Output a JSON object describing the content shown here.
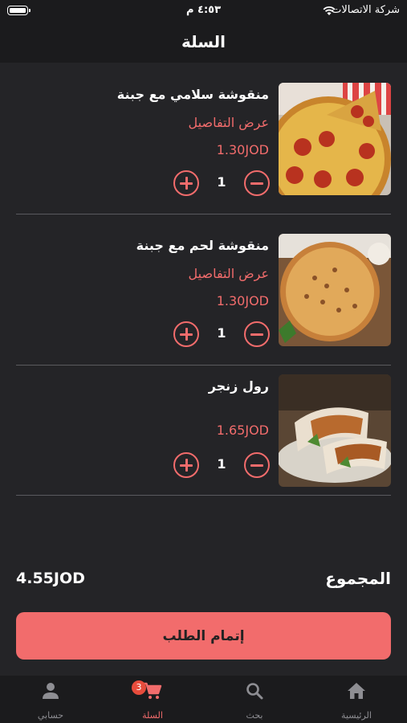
{
  "status_bar": {
    "carrier": "شركة الاتصالات",
    "time": "٤:٥٣ م"
  },
  "header": {
    "title": "السلة"
  },
  "cart": {
    "items": [
      {
        "name": "منقوشة سلامي مع جبنة",
        "details_label": "عرض التفاصيل",
        "price": "1.30JOD",
        "quantity": "1",
        "image": "pepperoni-pizza"
      },
      {
        "name": "منقوشة لحم مع جبنة",
        "details_label": "عرض التفاصيل",
        "price": "1.30JOD",
        "quantity": "1",
        "image": "meat-cheese-pizza"
      },
      {
        "name": "رول زنجر",
        "price": "1.65JOD",
        "quantity": "1",
        "image": "zinger-wrap"
      }
    ],
    "total_label": "المجموع",
    "total_value": "4.55JOD",
    "checkout_label": "إتمام الطلب"
  },
  "tab_bar": {
    "tabs": [
      {
        "label": "الرئيسية",
        "icon": "home-icon"
      },
      {
        "label": "بحث",
        "icon": "search-icon"
      },
      {
        "label": "السلة",
        "icon": "cart-icon",
        "active": true,
        "badge": "3"
      },
      {
        "label": "حسابي",
        "icon": "person-icon"
      }
    ]
  },
  "colors": {
    "accent": "#f26c6c",
    "background": "#242427",
    "bar": "#1b1b1d"
  }
}
